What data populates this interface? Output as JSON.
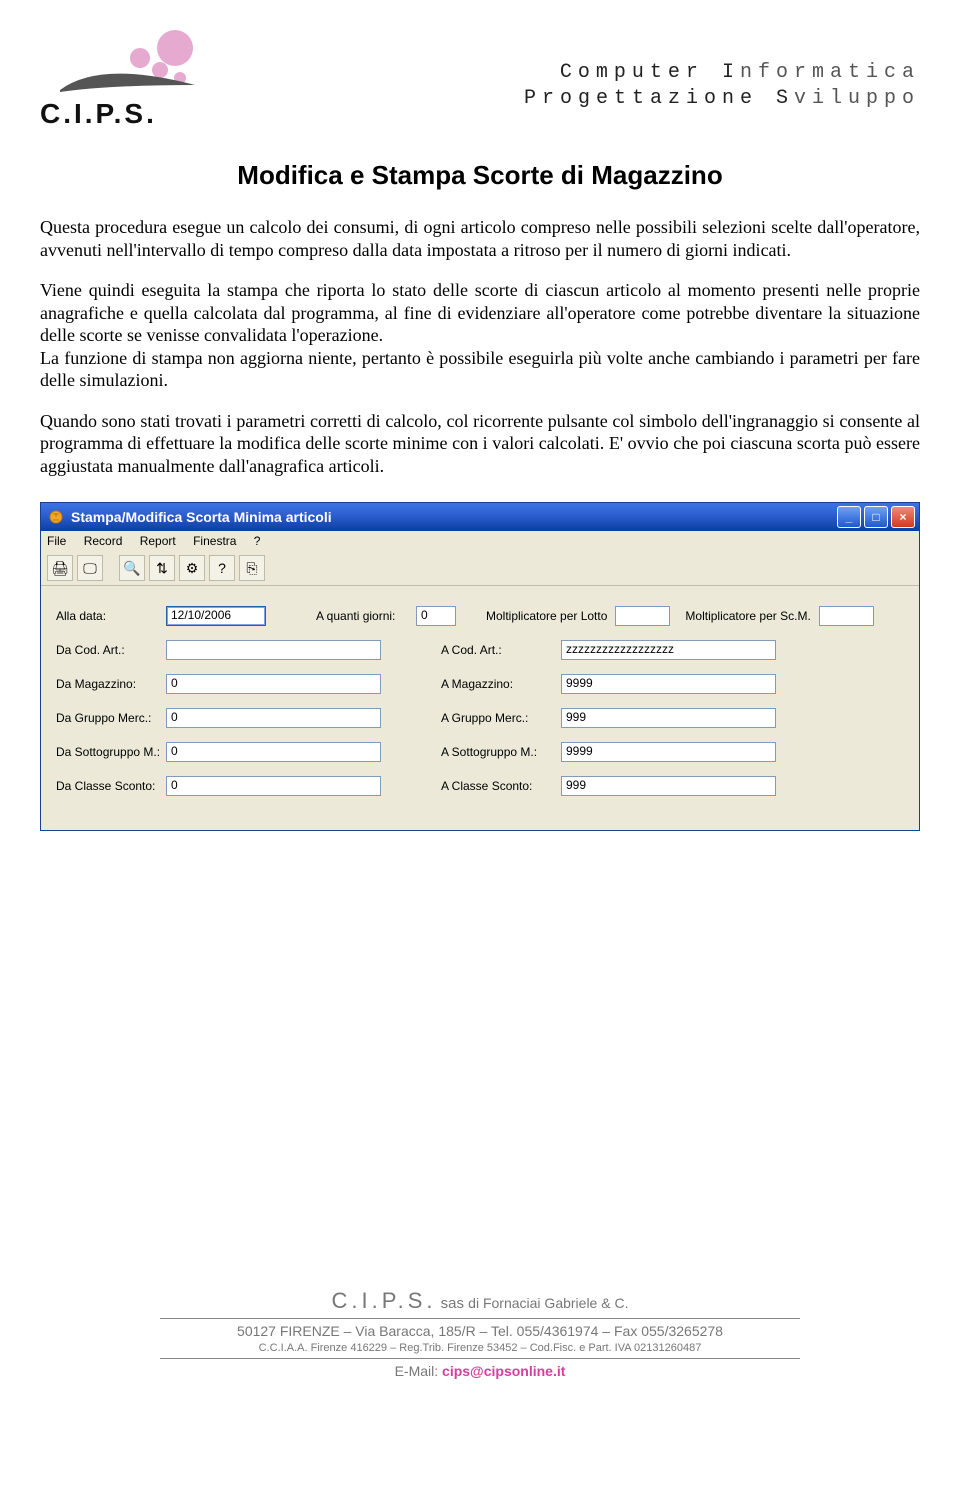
{
  "header": {
    "logo_text": "C.I.P.S.",
    "right_line1_a": "Computer ",
    "right_line1_b": "I",
    "right_line1_c": "nformatica",
    "right_line2_a": "Progettazione ",
    "right_line2_b": "S",
    "right_line2_c": "viluppo"
  },
  "title": "Modifica e Stampa Scorte di Magazzino",
  "paragraphs": {
    "p1": "Questa procedura esegue un calcolo dei consumi, di ogni articolo compreso nelle possibili selezioni scelte dall'operatore, avvenuti nell'intervallo di tempo compreso dalla data impostata a ritroso per il numero di giorni indicati.",
    "p2": "Viene quindi eseguita la stampa che riporta lo stato delle scorte di ciascun articolo al momento presenti nelle proprie anagrafiche e quella calcolata dal programma, al fine di evidenziare all'operatore come potrebbe diventare la situazione delle scorte se venisse convalidata l'operazione.",
    "p3": "La funzione di stampa non aggiorna niente, pertanto è possibile eseguirla più volte anche cambiando i parametri per fare delle simulazioni.",
    "p4": "Quando sono stati trovati i parametri corretti di calcolo, col ricorrente pulsante col simbolo dell'ingranaggio si consente al programma di effettuare la modifica delle scorte minime con i valori calcolati. E' ovvio che poi ciascuna scorta può essere aggiustata manualmente dall'anagrafica articoli."
  },
  "window": {
    "title": "Stampa/Modifica Scorta Minima articoli",
    "menu": [
      "File",
      "Record",
      "Report",
      "Finestra",
      "?"
    ],
    "labels": {
      "alla_data": "Alla data:",
      "a_quanti_giorni": "A quanti giorni:",
      "molt_lotto": "Moltiplicatore per Lotto",
      "molt_scm": "Moltiplicatore per Sc.M.",
      "da_cod_art": "Da Cod. Art.:",
      "a_cod_art": "A Cod. Art.:",
      "da_magazzino": "Da Magazzino:",
      "a_magazzino": "A Magazzino:",
      "da_gruppo": "Da Gruppo Merc.:",
      "a_gruppo": "A Gruppo Merc.:",
      "da_sottogruppo": "Da Sottogruppo M.:",
      "a_sottogruppo": "A Sottogruppo M.:",
      "da_classe": "Da Classe Sconto:",
      "a_classe": "A Classe Sconto:"
    },
    "values": {
      "alla_data": "12/10/2006",
      "a_quanti_giorni": "0",
      "molt_lotto": "",
      "molt_scm": "",
      "da_cod_art": "",
      "a_cod_art": "zzzzzzzzzzzzzzzzzz",
      "da_magazzino": "0",
      "a_magazzino": "9999",
      "da_gruppo": "0",
      "a_gruppo": "999",
      "da_sottogruppo": "0",
      "a_sottogruppo": "9999",
      "da_classe": "0",
      "a_classe": "999"
    }
  },
  "footer": {
    "company": "C.I.P.S.",
    "sas": " sas ",
    "owner": "di Fornaciai Gabriele & C.",
    "address": "50127 FIRENZE – Via Baracca, 185/R – Tel. 055/4361974 – Fax 055/3265278",
    "legal": "C.C.I.A.A. Firenze 416229 – Reg.Trib. Firenze 53452 – Cod.Fisc. e Part. IVA 02131260487",
    "email_label": "E-Mail: ",
    "email": "cips@cipsonline.it"
  }
}
